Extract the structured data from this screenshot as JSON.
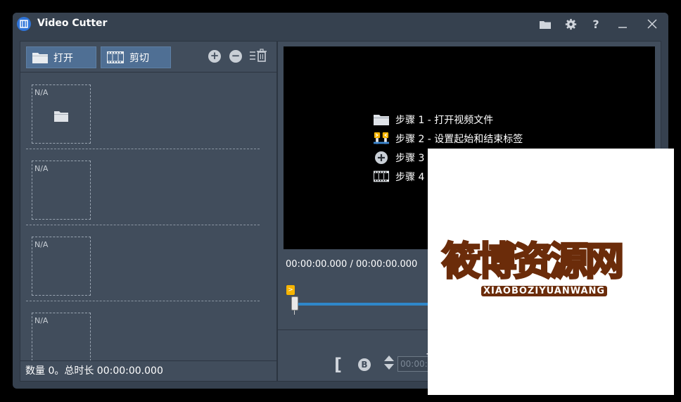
{
  "window": {
    "title": "Video Cutter",
    "icons": [
      "folder-icon",
      "gear-icon",
      "help-icon",
      "minimize-icon",
      "close-icon"
    ],
    "help_glyph": "?"
  },
  "toolbar": {
    "open_label": "打开",
    "cut_label": "剪切",
    "add_glyph": "+",
    "remove_glyph": "−"
  },
  "file_list": {
    "items": [
      {
        "label": "N/A"
      },
      {
        "label": "N/A"
      },
      {
        "label": "N/A"
      },
      {
        "label": "N/A"
      }
    ]
  },
  "status": {
    "summary": "数量 0。总时长 00:00:00.000"
  },
  "preview": {
    "steps": [
      {
        "icon": "folder-icon",
        "text": "步骤 1 - 打开视频文件"
      },
      {
        "icon": "markers-icon",
        "text": "步骤 2 - 设置起始和结束标签"
      },
      {
        "icon": "add-icon",
        "text": "步骤 3"
      },
      {
        "icon": "film-icon",
        "text": "步骤 4"
      }
    ]
  },
  "timeline": {
    "time_display": "00:00:00.000 / 00:00:00.000",
    "marker_glyph": ">",
    "position": 0
  },
  "controls": {
    "bracket_glyph": "[",
    "b_glyph": "B",
    "time_input_value": "00:00:",
    "plus_partial": "+"
  },
  "watermark": {
    "main": "筱博资源网",
    "sub": "XIAOBOZIYUANWANG"
  },
  "colors": {
    "window_bg": "#36414f",
    "panel_bg": "#414d5c",
    "button_bg": "#4f6f94",
    "track": "#2f87c9",
    "marker": "#f6b400"
  }
}
